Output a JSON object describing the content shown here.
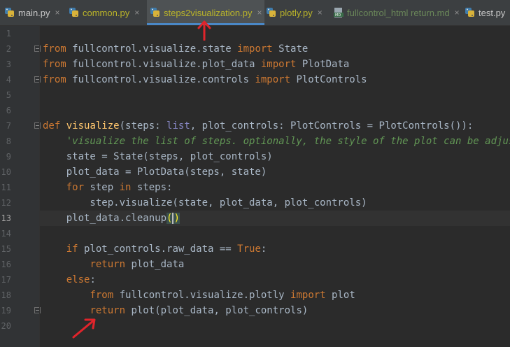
{
  "tabs": [
    {
      "label": "main.py",
      "icon": "python-file-icon",
      "close": "×"
    },
    {
      "label": "common.py",
      "icon": "python-file-icon",
      "close": "×"
    },
    {
      "label": "steps2visualization.py",
      "icon": "python-file-icon",
      "close": "×"
    },
    {
      "label": "plotly.py",
      "icon": "python-file-icon",
      "close": "×"
    },
    {
      "label": "fullcontrol_html return.md",
      "icon": "markdown-file-icon",
      "close": "×"
    },
    {
      "label": "test.py",
      "icon": "python-file-icon",
      "close": "×"
    }
  ],
  "active_tab": "steps2visualization.py",
  "line_numbers": [
    "1",
    "2",
    "3",
    "4",
    "5",
    "6",
    "7",
    "8",
    "9",
    "10",
    "11",
    "12",
    "13",
    "14",
    "15",
    "16",
    "17",
    "18",
    "19",
    "20"
  ],
  "current_line": "13",
  "code": {
    "l2": {
      "t1": "from",
      "t2": " fullcontrol.visualize.state ",
      "t3": "import",
      "t4": " State"
    },
    "l3": {
      "t1": "from",
      "t2": " fullcontrol.visualize.plot_data ",
      "t3": "import",
      "t4": " PlotData"
    },
    "l4": {
      "t1": "from",
      "t2": " fullcontrol.visualize.controls ",
      "t3": "import",
      "t4": " PlotControls"
    },
    "l7": {
      "t1": "def",
      "t2": " ",
      "t3": "visualize",
      "t4": "(steps: ",
      "t5": "list",
      "t6": ", plot_controls: PlotControls = PlotControls()):"
    },
    "l8": {
      "t1": "    'visualize the list of steps. optionally, the style of the plot can be adjusted"
    },
    "l9": {
      "t1": "    state = State(steps, plot_controls)"
    },
    "l10": {
      "t1": "    plot_data = PlotData(steps, state)"
    },
    "l11": {
      "t1": "    ",
      "t2": "for",
      "t3": " step ",
      "t4": "in",
      "t5": " steps:"
    },
    "l12": {
      "t1": "        step.visualize(state, plot_data, plot_controls)"
    },
    "l13": {
      "t1": "    plot_data.cleanup",
      "t2": "(",
      "t3": ")"
    },
    "l15": {
      "t1": "    ",
      "t2": "if",
      "t3": " plot_controls.raw_data == ",
      "t4": "True",
      "t5": ":"
    },
    "l16": {
      "t1": "        ",
      "t2": "return",
      "t3": " plot_data"
    },
    "l17": {
      "t1": "    ",
      "t2": "else",
      "t3": ":"
    },
    "l18": {
      "t1": "        ",
      "t2": "from",
      "t3": " fullcontrol.visualize.plotly ",
      "t4": "import",
      "t5": " plot"
    },
    "l19": {
      "t1": "        ",
      "t2": "return",
      "t3": " plot(plot_data, plot_controls)"
    }
  },
  "colors": {
    "background": "#2b2b2b",
    "keyword": "#cc7832",
    "function": "#ffc66d",
    "string": "#629755",
    "builtin": "#8888c6",
    "annotation_arrow": "#e0242b"
  }
}
